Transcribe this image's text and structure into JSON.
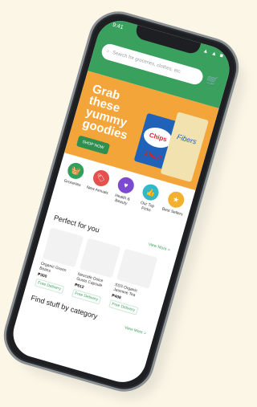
{
  "status": {
    "time": "9:41",
    "icons": "▲ ▲ ■"
  },
  "search": {
    "placeholder": "Search for groceries, clothes, etc.",
    "icon": "search-icon"
  },
  "banner": {
    "headline": "Grab these yummy goodies",
    "cta": "SHOP NOW",
    "product_labels": [
      "Chips Ahoy!",
      "Fibers"
    ]
  },
  "categories": [
    {
      "label": "Groceries",
      "color": "#2fa15a",
      "icon": "basket-icon"
    },
    {
      "label": "New Arrivals",
      "color": "#e3504d",
      "icon": "tag-icon"
    },
    {
      "label": "Health & Beauty",
      "color": "#7b4ad1",
      "icon": "heart-icon"
    },
    {
      "label": "Our Top Picks",
      "color": "#34b7c7",
      "icon": "thumb-icon"
    },
    {
      "label": "Best Sellers",
      "color": "#f2b02c",
      "icon": "medal-icon"
    }
  ],
  "perfect_for_you": {
    "title": "Perfect for you",
    "more": "View More >",
    "products": [
      {
        "name": "Organic Green Beans",
        "price": "₱300",
        "tag": "Free Delivery"
      },
      {
        "name": "Nescafe Dolce Gusto Capsule",
        "price": "₱612",
        "tag": "Free Delivery"
      },
      {
        "name": "SSS Organic Jasmine Tea",
        "price": "₱408",
        "tag": "Free Delivery"
      }
    ]
  },
  "category_section": {
    "title": "Find stuff by category",
    "more": "View More >"
  }
}
